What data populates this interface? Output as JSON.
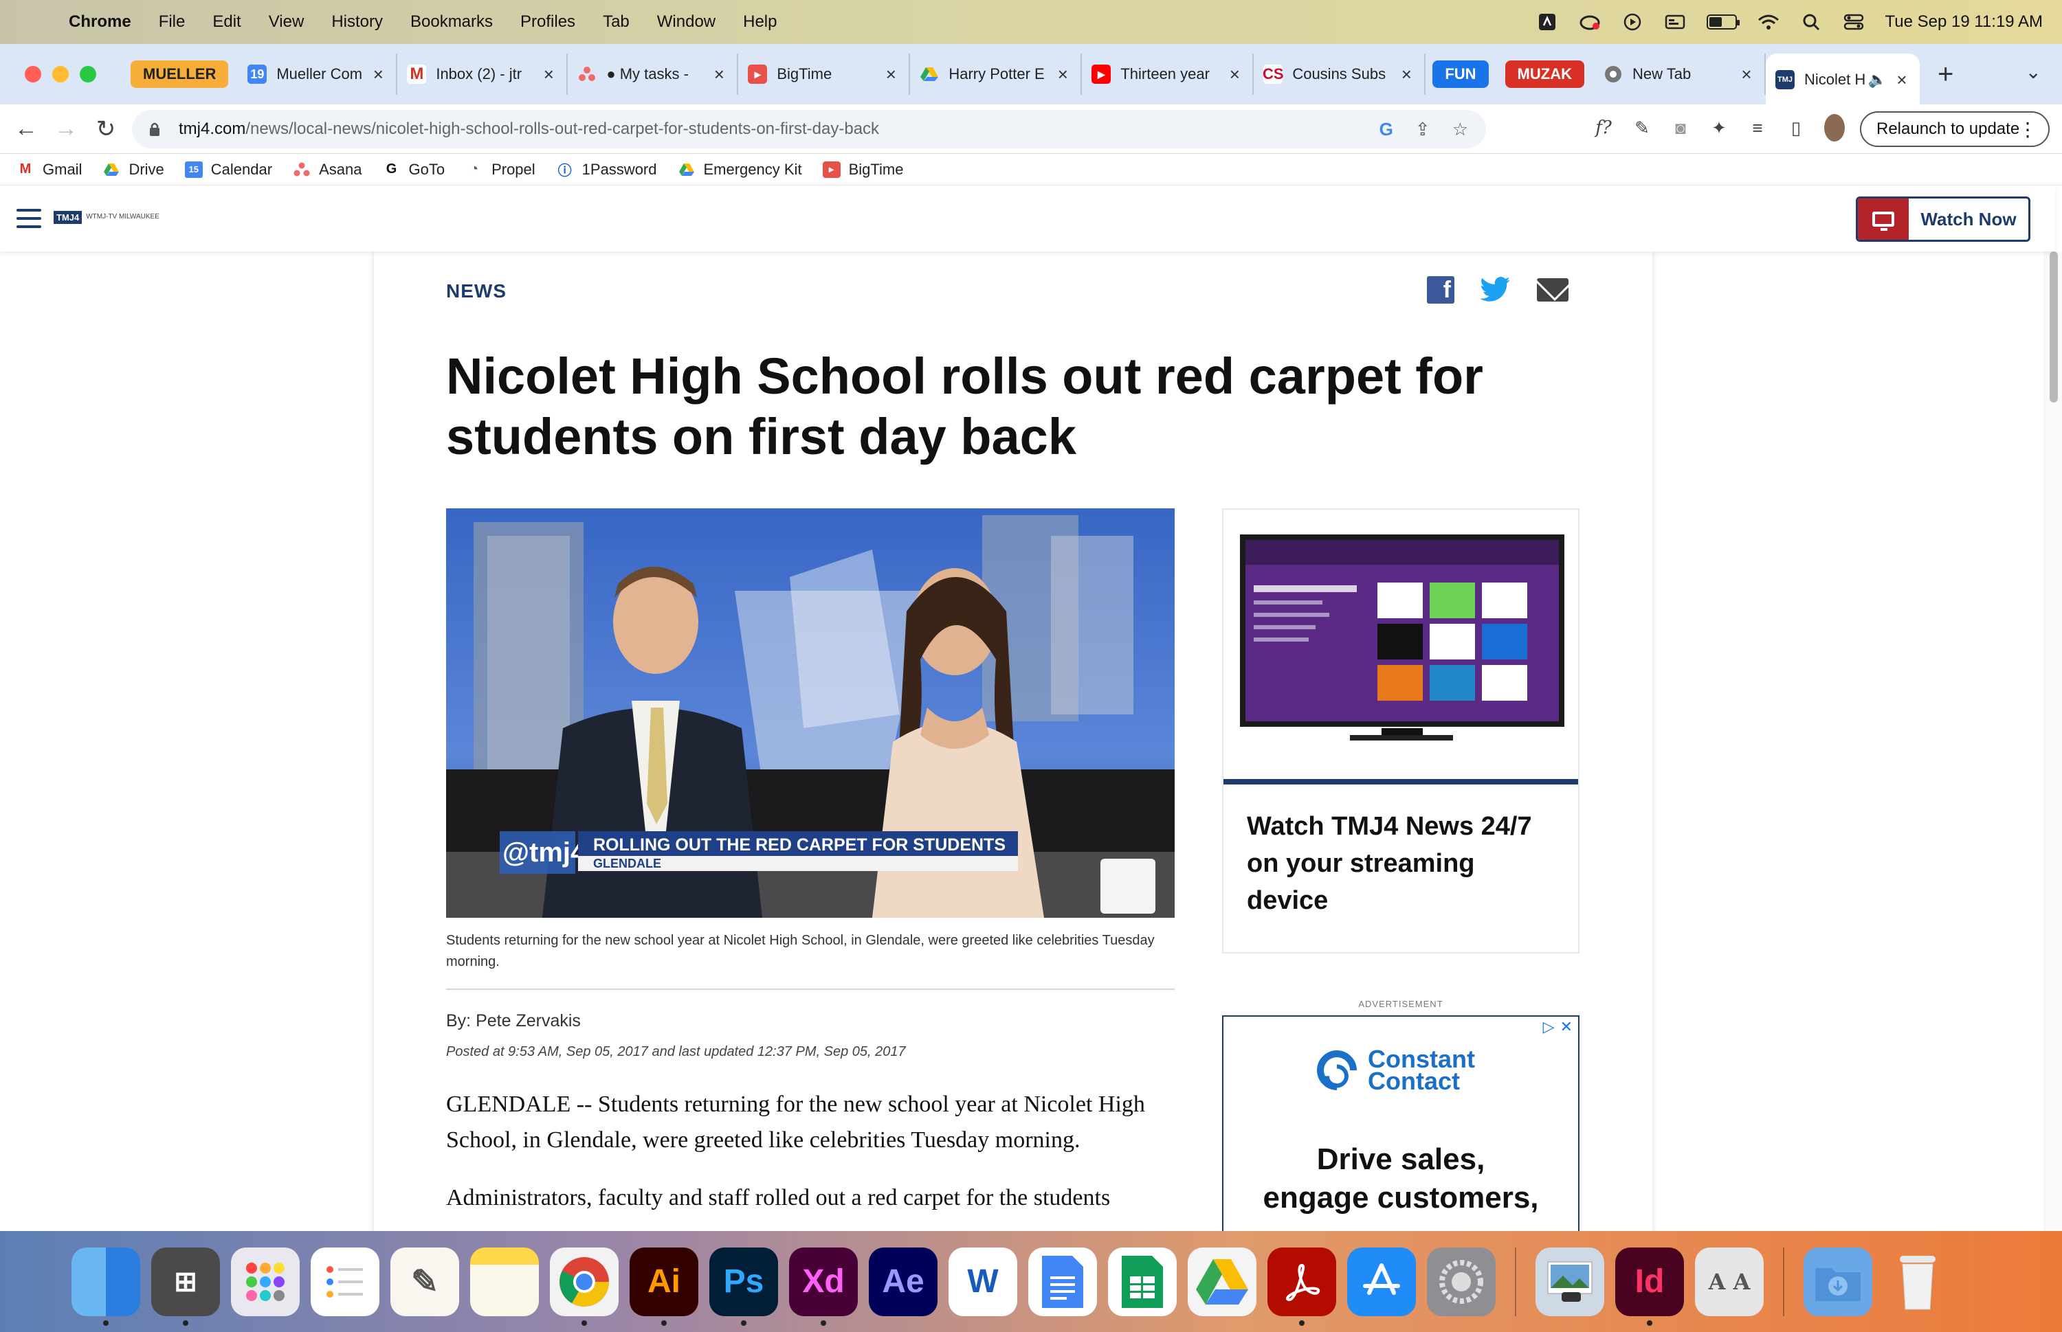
{
  "menubar": {
    "app_name": "Chrome",
    "items": [
      "File",
      "Edit",
      "View",
      "History",
      "Bookmarks",
      "Profiles",
      "Tab",
      "Window",
      "Help"
    ],
    "datetime": "Tue Sep 19  11:19 AM"
  },
  "tabs": {
    "group_mueller": "MUELLER",
    "group_fun": "FUN",
    "group_muzak": "MUZAK",
    "items": [
      {
        "label": "Mueller Comm",
        "icon": "calendar-icon"
      },
      {
        "label": "Inbox (2) - jtr",
        "icon": "gmail-icon"
      },
      {
        "label": "● My tasks -",
        "icon": "asana-icon"
      },
      {
        "label": "BigTime",
        "icon": "bigtime-icon"
      },
      {
        "label": "Harry Potter E",
        "icon": "drive-icon"
      },
      {
        "label": "Thirteen year",
        "icon": "youtube-icon"
      },
      {
        "label": "Cousins Subs",
        "icon": "cousins-icon"
      },
      {
        "label": "New Tab",
        "icon": "chrome-icon"
      },
      {
        "label": "Nicolet H",
        "icon": "tmj4-icon"
      }
    ]
  },
  "omnibox": {
    "url_host": "tmj4.com",
    "url_path": "/news/local-news/nicolet-high-school-rolls-out-red-carpet-for-students-on-first-day-back"
  },
  "relaunch_label": "Relaunch to update",
  "bookmarks": [
    "Gmail",
    "Drive",
    "Calendar",
    "Asana",
    "GoTo",
    "Propel",
    "1Password",
    "Emergency Kit",
    "BigTime"
  ],
  "site": {
    "watch_now": "Watch Now",
    "logo_text": "TMJ4",
    "logo_sub": "WTMJ-TV MILWAUKEE"
  },
  "article": {
    "section": "NEWS",
    "headline": "Nicolet High School rolls out red carpet for students on first day back",
    "lower_third_handle": "@tmj4",
    "lower_third_title": "ROLLING OUT THE RED CARPET FOR STUDENTS",
    "lower_third_location": "GLENDALE",
    "caption": "Students returning for the new school year at Nicolet High School, in Glendale, were greeted like celebrities Tuesday morning.",
    "byline": "By: Pete Zervakis",
    "posted": "Posted at 9:53 AM, Sep 05, 2017 and last updated 12:37 PM, Sep 05, 2017",
    "paragraphs": [
      "GLENDALE -- Students returning for the new school year at Nicolet High School, in Glendale, were greeted like celebrities Tuesday morning.",
      "Administrators, faculty and staff rolled out a red carpet for the students"
    ]
  },
  "promo": {
    "title": "Watch TMJ4 News 24/7 on your streaming device"
  },
  "ad": {
    "label": "ADVERTISEMENT",
    "brand_line1": "Constant",
    "brand_line2": "Contact",
    "headline_line1": "Drive sales,",
    "headline_line2": "engage customers,"
  },
  "colors": {
    "brand_navy": "#1d3b6b",
    "watch_red": "#b3232a",
    "tab_strip": "#dbe6f7"
  }
}
